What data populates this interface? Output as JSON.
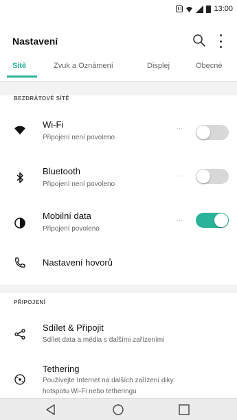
{
  "status_bar": {
    "time": "13:00",
    "icons": [
      "nfc-icon",
      "wifi-signal-icon",
      "cell-signal-icon",
      "battery-icon"
    ]
  },
  "app_bar": {
    "title": "Nastavení",
    "actions": [
      "search-icon",
      "more-vert-icon"
    ]
  },
  "tabs": [
    {
      "label": "Sítě",
      "active": true
    },
    {
      "label": "Zvuk a Oznámení",
      "active": false
    },
    {
      "label": "Displej",
      "active": false
    },
    {
      "label": "Obecné",
      "active": false
    }
  ],
  "accent_color": "#2bb39a",
  "sections": [
    {
      "header": "BEZDRÁTOVÉ SÍTĚ",
      "items": [
        {
          "title": "Wi-Fi",
          "subtitle": "Připojení není povoleno",
          "icon": "wifi-icon",
          "toggle": false
        },
        {
          "title": "Bluetooth",
          "subtitle": "Připojení není povoleno",
          "icon": "bluetooth-icon",
          "toggle": false
        },
        {
          "title": "Mobilní data",
          "subtitle": "Připojení povoleno",
          "icon": "mobile-data-icon",
          "toggle": true
        },
        {
          "title": "Nastavení hovorů",
          "subtitle": "",
          "icon": "phone-icon"
        }
      ]
    },
    {
      "header": "PŘIPOJENÍ",
      "items": [
        {
          "title": "Sdílet & Připojit",
          "subtitle": "Sdílet data a média s dalšími zařízeními",
          "icon": "share-icon"
        },
        {
          "title": "Tethering",
          "subtitle": "Používejte Internet na dalších zařízení diky",
          "subtitle2": "hotspotu Wi-Fi nebo tetheringu",
          "icon": "tethering-icon"
        }
      ]
    }
  ],
  "nav_bar": {
    "buttons": [
      "back-icon",
      "home-icon",
      "recents-icon"
    ]
  }
}
